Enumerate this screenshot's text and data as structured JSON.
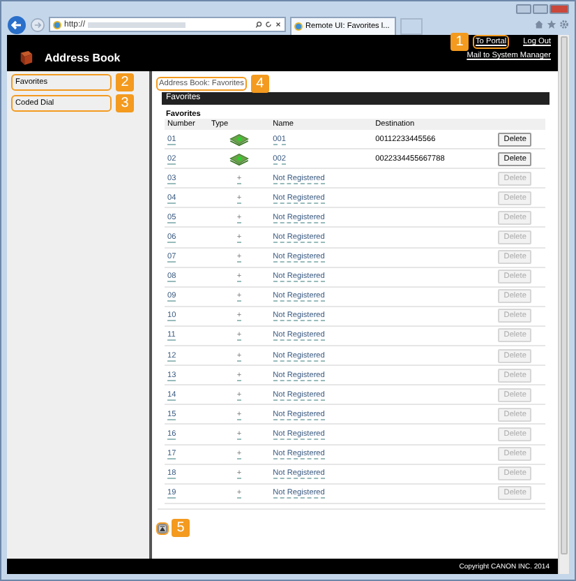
{
  "browser": {
    "address": "http://",
    "tab_title": "Remote UI: Favorites l..."
  },
  "header": {
    "title": "Address Book",
    "links": [
      {
        "label": "To Portal",
        "callout": "1"
      },
      {
        "label": "Log Out"
      }
    ],
    "mail_link": "Mail to System Manager"
  },
  "sidebar": [
    {
      "label": "Favorites",
      "callout": "2"
    },
    {
      "label": "Coded Dial",
      "callout": "3"
    }
  ],
  "breadcrumb": {
    "label": "Address Book: Favorites",
    "callout": "4"
  },
  "panel_title": "Favorites",
  "section_title": "Favorites",
  "columns": [
    "Number",
    "Type",
    "Name",
    "Destination"
  ],
  "rows": [
    {
      "number": "01",
      "kind": "entry",
      "name": "001",
      "destination": "00112233445566",
      "action": "Delete",
      "disabled": false
    },
    {
      "number": "02",
      "kind": "entry",
      "name": "002",
      "destination": "0022334455667788",
      "action": "Delete",
      "disabled": false
    },
    {
      "number": "03",
      "kind": "empty",
      "type": "+",
      "name": "Not Registered",
      "action": "Delete",
      "disabled": true
    },
    {
      "number": "04",
      "kind": "empty",
      "type": "+",
      "name": "Not Registered",
      "action": "Delete",
      "disabled": true
    },
    {
      "number": "05",
      "kind": "empty",
      "type": "+",
      "name": "Not Registered",
      "action": "Delete",
      "disabled": true
    },
    {
      "number": "06",
      "kind": "empty",
      "type": "+",
      "name": "Not Registered",
      "action": "Delete",
      "disabled": true
    },
    {
      "number": "07",
      "kind": "empty",
      "type": "+",
      "name": "Not Registered",
      "action": "Delete",
      "disabled": true
    },
    {
      "number": "08",
      "kind": "empty",
      "type": "+",
      "name": "Not Registered",
      "action": "Delete",
      "disabled": true
    },
    {
      "number": "09",
      "kind": "empty",
      "type": "+",
      "name": "Not Registered",
      "action": "Delete",
      "disabled": true
    },
    {
      "number": "10",
      "kind": "empty",
      "type": "+",
      "name": "Not Registered",
      "action": "Delete",
      "disabled": true
    },
    {
      "number": "11",
      "kind": "empty",
      "type": "+",
      "name": "Not Registered",
      "action": "Delete",
      "disabled": true
    },
    {
      "number": "12",
      "kind": "empty",
      "type": "+",
      "name": "Not Registered",
      "action": "Delete",
      "disabled": true
    },
    {
      "number": "13",
      "kind": "empty",
      "type": "+",
      "name": "Not Registered",
      "action": "Delete",
      "disabled": true
    },
    {
      "number": "14",
      "kind": "empty",
      "type": "+",
      "name": "Not Registered",
      "action": "Delete",
      "disabled": true
    },
    {
      "number": "15",
      "kind": "empty",
      "type": "+",
      "name": "Not Registered",
      "action": "Delete",
      "disabled": true
    },
    {
      "number": "16",
      "kind": "empty",
      "type": "+",
      "name": "Not Registered",
      "action": "Delete",
      "disabled": true
    },
    {
      "number": "17",
      "kind": "empty",
      "type": "+",
      "name": "Not Registered",
      "action": "Delete",
      "disabled": true
    },
    {
      "number": "18",
      "kind": "empty",
      "type": "+",
      "name": "Not Registered",
      "action": "Delete",
      "disabled": true
    },
    {
      "number": "19",
      "kind": "empty",
      "type": "+",
      "name": "Not Registered",
      "action": "Delete",
      "disabled": true
    }
  ],
  "top_button": {
    "callout": "5"
  },
  "footer": "Copyright CANON INC. 2014"
}
